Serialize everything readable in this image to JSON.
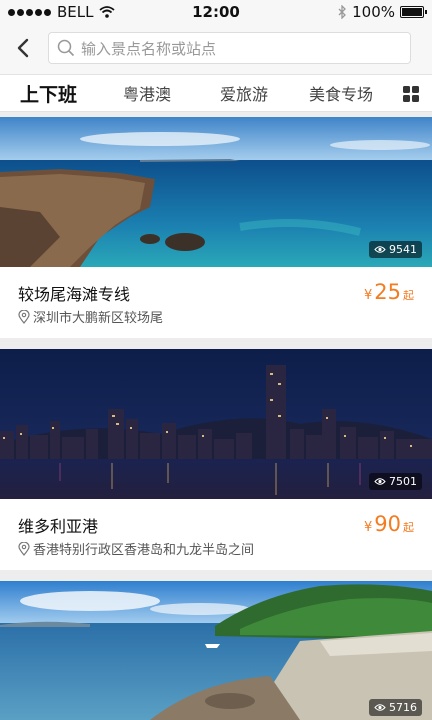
{
  "status_bar": {
    "carrier": "BELL",
    "time": "12:00",
    "battery": "100%"
  },
  "search": {
    "placeholder": "输入景点名称或站点"
  },
  "tabs": [
    {
      "label": "上下班",
      "active": true
    },
    {
      "label": "粤港澳",
      "active": false
    },
    {
      "label": "爱旅游",
      "active": false
    },
    {
      "label": "美食专场",
      "active": false
    }
  ],
  "cards": [
    {
      "title": "较场尾海滩专线",
      "address": "深圳市大鹏新区较场尾",
      "price_currency": "¥",
      "price": "25",
      "price_unit": "起",
      "views": "9541"
    },
    {
      "title": "维多利亚港",
      "address": "香港特别行政区香港岛和九龙半岛之间",
      "price_currency": "¥",
      "price": "90",
      "price_unit": "起",
      "views": "7501"
    },
    {
      "views": "5716"
    }
  ],
  "colors": {
    "accent": "#f47b20"
  }
}
